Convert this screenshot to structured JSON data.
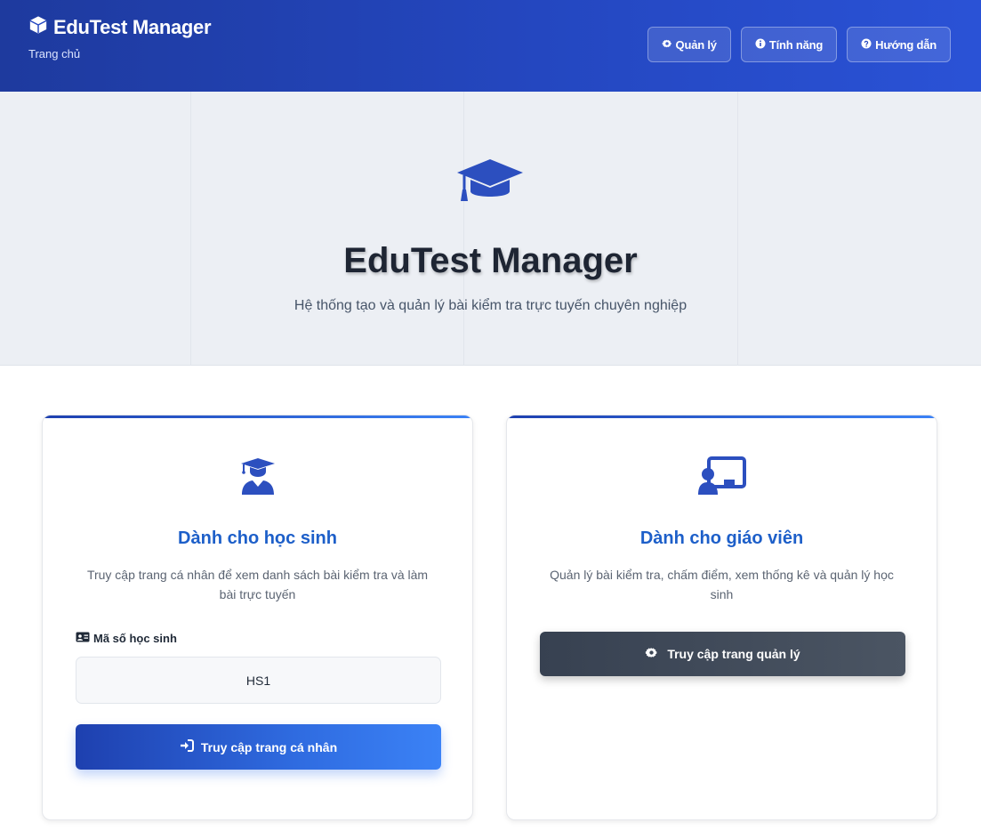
{
  "header": {
    "brand": "EduTest Manager",
    "breadcrumb": "Trang chủ",
    "nav": [
      {
        "label": "Quản lý",
        "icon": "gear-icon"
      },
      {
        "label": "Tính năng",
        "icon": "info-icon"
      },
      {
        "label": "Hướng dẫn",
        "icon": "help-icon"
      }
    ]
  },
  "hero": {
    "title": "EduTest Manager",
    "subtitle": "Hệ thống tạo và quản lý bài kiểm tra trực tuyến chuyên nghiệp",
    "icon": "graduation-cap-icon"
  },
  "student_card": {
    "icon": "student-icon",
    "title": "Dành cho học sinh",
    "description": "Truy cập trang cá nhân để xem danh sách bài kiểm tra và làm bài trực tuyến",
    "field_label": "Mã số học sinh",
    "field_value": "HS1",
    "button_label": "Truy cập trang cá nhân"
  },
  "teacher_card": {
    "icon": "teacher-icon",
    "title": "Dành cho giáo viên",
    "description": "Quản lý bài kiểm tra, chấm điểm, xem thống kê và quản lý học sinh",
    "button_label": "Truy cập trang quản lý"
  },
  "colors": {
    "header": "#2447c0",
    "accent": "#1d5fc9",
    "dark_button": "#374151"
  }
}
